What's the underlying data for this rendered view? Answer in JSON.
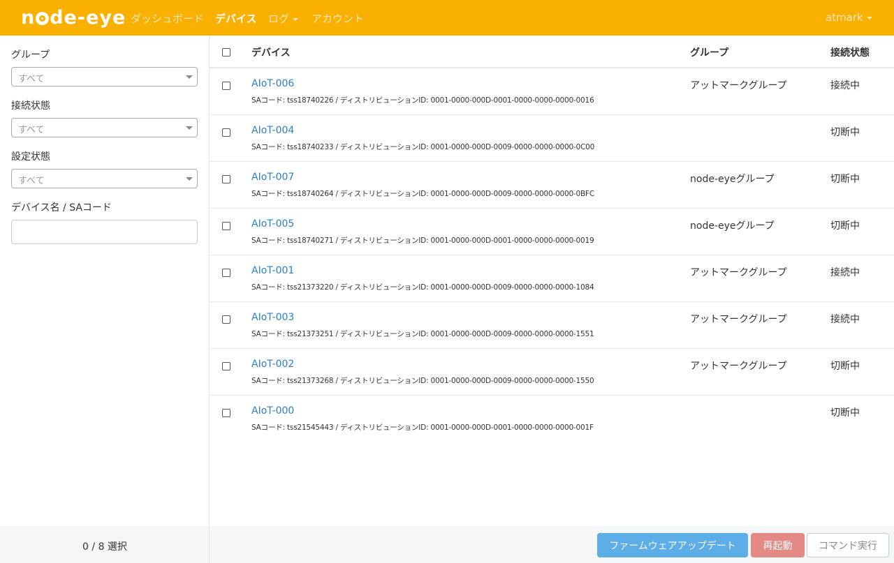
{
  "header": {
    "logo_text": "node-eye",
    "nav": [
      {
        "label": "ダッシュボード"
      },
      {
        "label": "デバイス"
      },
      {
        "label": "ログ"
      },
      {
        "label": "アカウント"
      }
    ],
    "user": "atmark"
  },
  "sidebar": {
    "filters": {
      "group": {
        "label": "グループ",
        "value": "すべて"
      },
      "connection": {
        "label": "接続状態",
        "value": "すべて"
      },
      "config": {
        "label": "設定状態",
        "value": "すべて"
      },
      "search": {
        "label": "デバイス名 / SAコード",
        "value": "",
        "placeholder": ""
      }
    }
  },
  "table": {
    "headers": {
      "device": "デバイス",
      "group": "グループ",
      "status": "接続状態"
    },
    "rows": [
      {
        "name": "AIoT-006",
        "sub": "SAコード: tss18740226 / ディストリビューションID: 0001-0000-000D-0001-0000-0000-0000-0016",
        "group": "アットマークグループ",
        "status": "接続中"
      },
      {
        "name": "AIoT-004",
        "sub": "SAコード: tss18740233 / ディストリビューションID: 0001-0000-000D-0009-0000-0000-0000-0C00",
        "group": "",
        "status": "切断中"
      },
      {
        "name": "AIoT-007",
        "sub": "SAコード: tss18740264 / ディストリビューションID: 0001-0000-000D-0009-0000-0000-0000-0BFC",
        "group": "node-eyeグループ",
        "status": "切断中"
      },
      {
        "name": "AIoT-005",
        "sub": "SAコード: tss18740271 / ディストリビューションID: 0001-0000-000D-0001-0000-0000-0000-0019",
        "group": "node-eyeグループ",
        "status": "切断中"
      },
      {
        "name": "AIoT-001",
        "sub": "SAコード: tss21373220 / ディストリビューションID: 0001-0000-000D-0009-0000-0000-0000-1084",
        "group": "アットマークグループ",
        "status": "接続中"
      },
      {
        "name": "AIoT-003",
        "sub": "SAコード: tss21373251 / ディストリビューションID: 0001-0000-000D-0009-0000-0000-0000-1551",
        "group": "アットマークグループ",
        "status": "接続中"
      },
      {
        "name": "AIoT-002",
        "sub": "SAコード: tss21373268 / ディストリビューションID: 0001-0000-000D-0009-0000-0000-0000-1550",
        "group": "アットマークグループ",
        "status": "切断中"
      },
      {
        "name": "AIoT-000",
        "sub": "SAコード: tss21545443 / ディストリビューションID: 0001-0000-000D-0001-0000-0000-0000-001F",
        "group": "",
        "status": "切断中"
      }
    ]
  },
  "footer": {
    "selection": "0 / 8 選択",
    "buttons": {
      "firmware": "ファームウェアアップデート",
      "reboot": "再起動",
      "command": "コマンド実行"
    }
  },
  "colors": {
    "brand": "#f9b000",
    "link": "#2a7fc9",
    "primary_button": "#5dade8",
    "danger_button": "#e38a85"
  }
}
